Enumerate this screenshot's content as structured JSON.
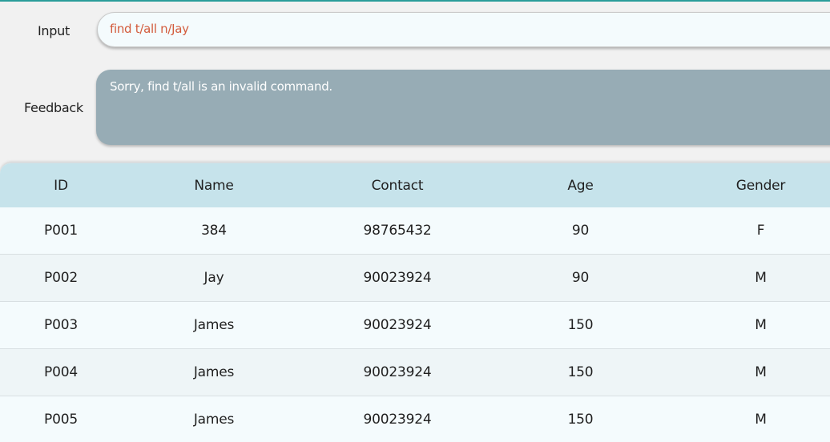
{
  "input": {
    "label": "Input",
    "command_text": "find t/all n/Jay"
  },
  "feedback": {
    "label": "Feedback",
    "message": "Sorry, find t/all is an invalid command."
  },
  "table": {
    "headers": [
      "ID",
      "Name",
      "Contact",
      "Age",
      "Gender"
    ],
    "rows": [
      [
        "P001",
        "384",
        "98765432",
        "90",
        "F"
      ],
      [
        "P002",
        "Jay",
        "90023924",
        "90",
        "M"
      ],
      [
        "P003",
        "James",
        "90023924",
        "150",
        "M"
      ],
      [
        "P004",
        "James",
        "90023924",
        "150",
        "M"
      ],
      [
        "P005",
        "James",
        "90023924",
        "150",
        "M"
      ]
    ]
  },
  "colors": {
    "accent_line": "#2a9d9a",
    "command_text": "#d35b3c",
    "feedback_background": "#97acb5",
    "table_header": "#c6e3eb"
  }
}
